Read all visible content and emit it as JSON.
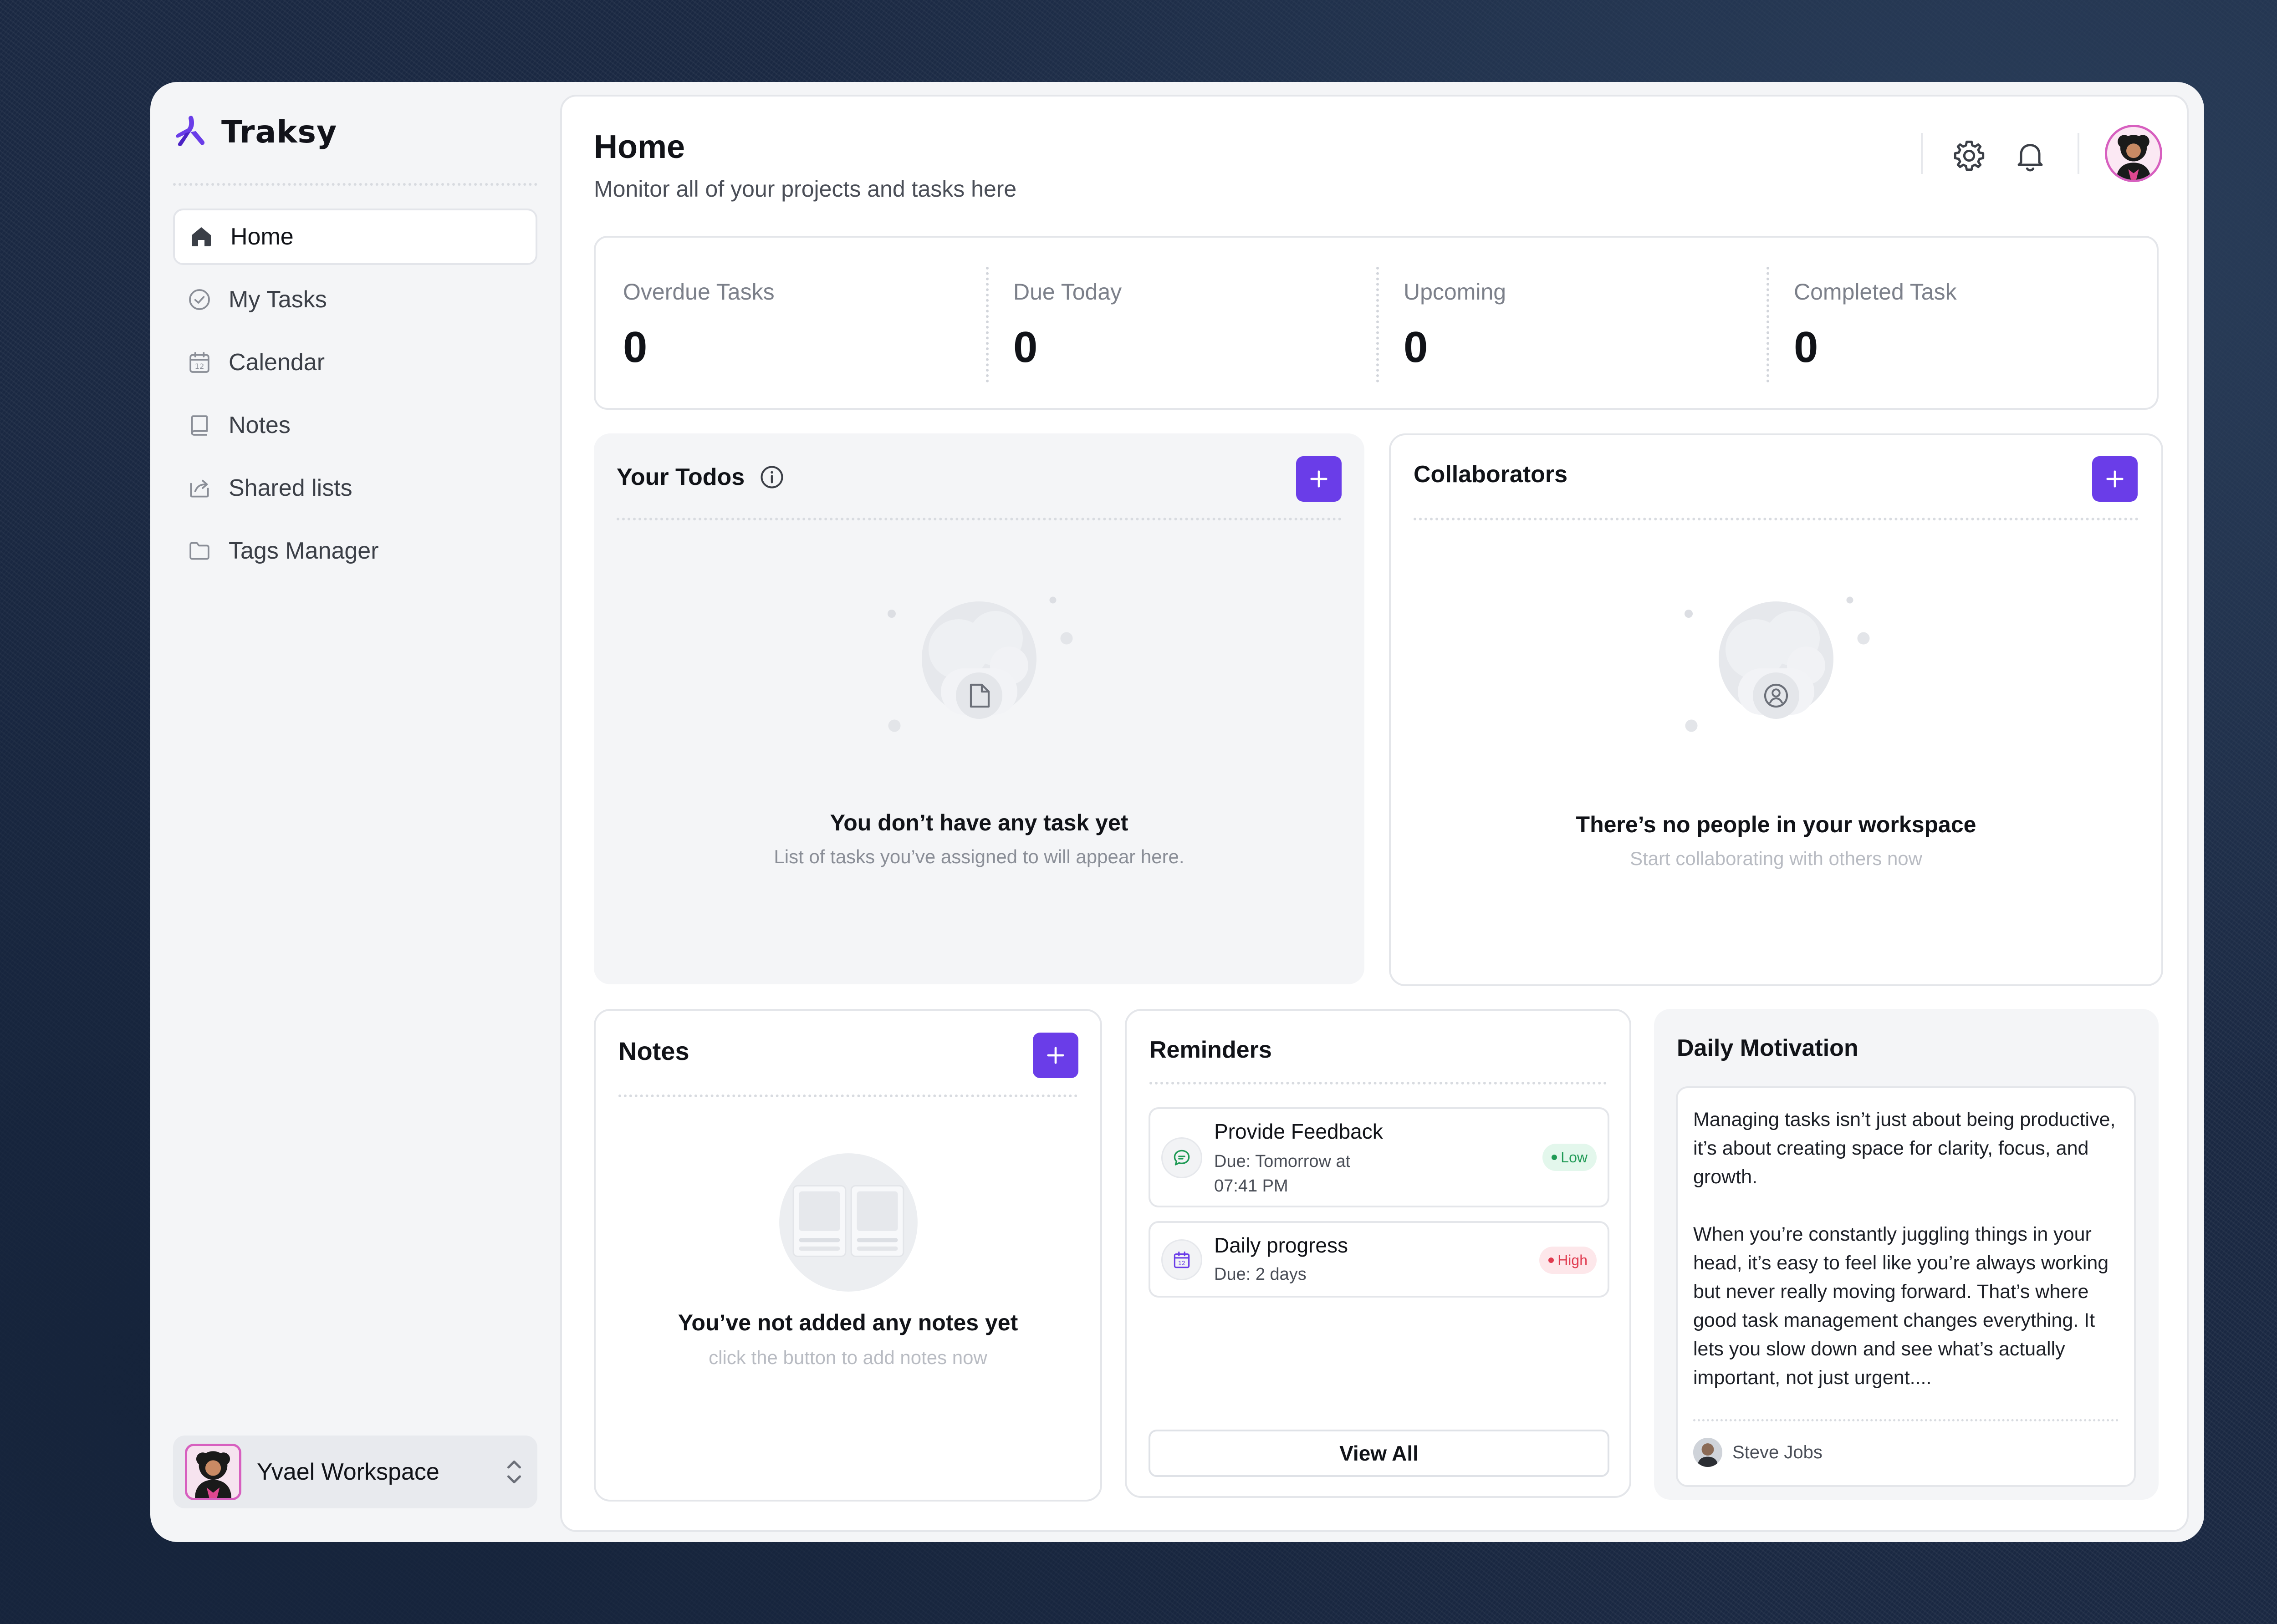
{
  "app": {
    "name": "Traksy"
  },
  "sidebar": {
    "items": [
      {
        "label": "Home",
        "icon": "home-icon",
        "active": true
      },
      {
        "label": "My Tasks",
        "icon": "check-circle-icon"
      },
      {
        "label": "Calendar",
        "icon": "calendar-icon"
      },
      {
        "label": "Notes",
        "icon": "book-icon"
      },
      {
        "label": "Shared lists",
        "icon": "share-icon"
      },
      {
        "label": "Tags Manager",
        "icon": "folder-icon"
      }
    ],
    "workspace": {
      "name": "Yvael Workspace"
    }
  },
  "header": {
    "title": "Home",
    "subtitle": "Monitor all of your projects and tasks here",
    "icons": [
      "gear-icon",
      "bell-icon"
    ]
  },
  "stats": [
    {
      "label": "Overdue Tasks",
      "value": "0"
    },
    {
      "label": "Due Today",
      "value": "0"
    },
    {
      "label": "Upcoming",
      "value": "0"
    },
    {
      "label": "Completed Task",
      "value": "0"
    }
  ],
  "todos": {
    "title": "Your Todos",
    "empty_title": "You don’t have any task yet",
    "empty_sub": "List of tasks you’ve assigned to will appear here."
  },
  "collaborators": {
    "title": "Collaborators",
    "empty_title": "There’s no people in your workspace",
    "empty_sub": "Start collaborating with others now"
  },
  "notes": {
    "title": "Notes",
    "empty_title": "You’ve not added any notes yet",
    "empty_sub": "click the button to add notes now"
  },
  "reminders": {
    "title": "Reminders",
    "items": [
      {
        "title": "Provide Feedback",
        "due_line1": "Due: Tomorrow at",
        "due_line2": "07:41 PM",
        "priority": "Low",
        "icon": "chat-icon"
      },
      {
        "title": "Daily progress",
        "due_line1": "Due: 2 days",
        "priority": "High",
        "icon": "calendar-icon"
      }
    ],
    "view_all": "View All"
  },
  "motivation": {
    "title": "Daily Motivation",
    "quote": "Managing tasks isn’t just about being productive, it’s about creating space for clarity, focus, and growth.\n\nWhen you’re constantly juggling things in your head, it’s easy to feel like you’re always working but never really moving forward. That’s where good task management changes everything. It lets you slow down and see what’s actually important, not just urgent....",
    "author": "Steve Jobs"
  },
  "colors": {
    "accent": "#6a3de8",
    "low": "#1f9a55",
    "high": "#e03a4f",
    "avatar_border": "#d75fbf"
  }
}
